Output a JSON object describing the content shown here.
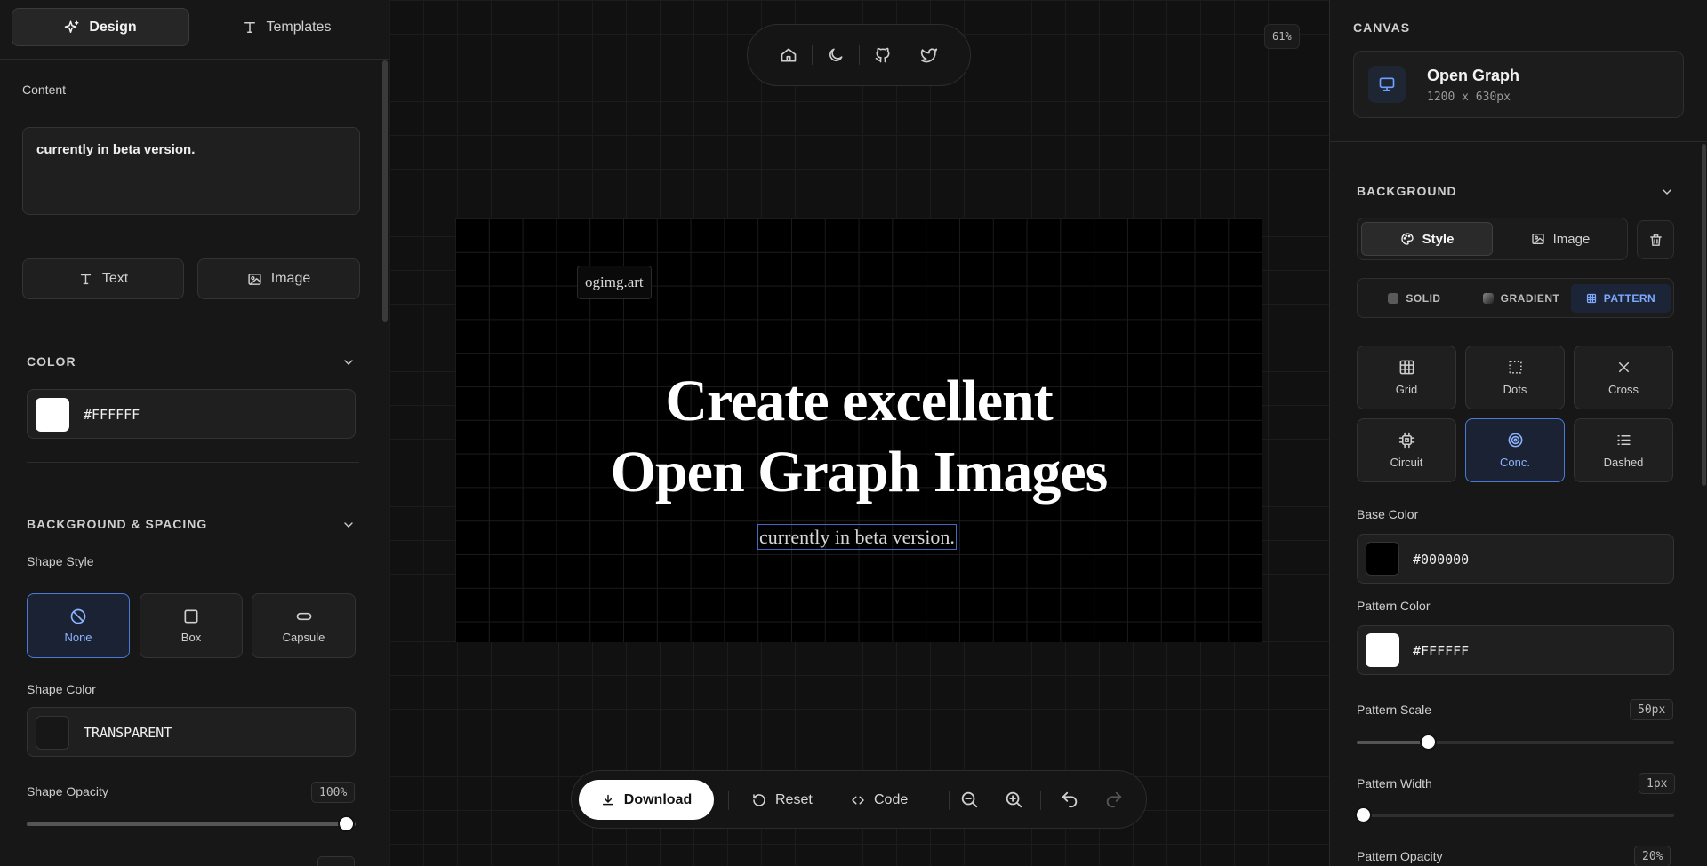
{
  "left": {
    "tabs": [
      {
        "label": "Design",
        "icon": "sparkles-icon",
        "active": true
      },
      {
        "label": "Templates",
        "icon": "text-type-icon",
        "active": false
      }
    ],
    "content_label": "Content",
    "content_value": "currently in beta version.",
    "add_text_label": "Text",
    "add_image_label": "Image",
    "color_heading": "COLOR",
    "color_value": "#FFFFFF",
    "bg_spacing_heading": "BACKGROUND & SPACING",
    "shape_style_label": "Shape Style",
    "shape_options": [
      {
        "label": "None",
        "icon": "ban-icon",
        "active": true
      },
      {
        "label": "Box",
        "icon": "square-icon",
        "active": false
      },
      {
        "label": "Capsule",
        "icon": "capsule-icon",
        "active": false
      }
    ],
    "shape_color_label": "Shape Color",
    "shape_color_value": "TRANSPARENT",
    "shape_opacity_label": "Shape Opacity",
    "shape_opacity_value": "100%",
    "shape_opacity_level": 1.0
  },
  "center": {
    "zoom": "61%",
    "nav_icons": [
      "home-icon",
      "moon-icon",
      "github-icon",
      "twitter-icon"
    ],
    "og": {
      "logo": "ogimg.art",
      "headline_1": "Create excellent",
      "headline_2": "Open Graph Images",
      "tagline": "currently in beta version."
    },
    "toolbar": {
      "download_label": "Download",
      "reset_label": "Reset",
      "code_label": "Code"
    }
  },
  "right": {
    "canvas_heading": "CANVAS",
    "canvas_name": "Open Graph",
    "canvas_size": "1200 x 630px",
    "background_heading": "BACKGROUND",
    "bg_tabs": [
      {
        "label": "Style",
        "active": true
      },
      {
        "label": "Image",
        "active": false
      }
    ],
    "modes": [
      {
        "label": "SOLID",
        "active": false
      },
      {
        "label": "GRADIENT",
        "active": false
      },
      {
        "label": "PATTERN",
        "active": true
      }
    ],
    "patterns": [
      {
        "label": "Grid",
        "icon": "grid-icon",
        "active": false
      },
      {
        "label": "Dots",
        "icon": "dots-icon",
        "active": false
      },
      {
        "label": "Cross",
        "icon": "x-icon",
        "active": false
      },
      {
        "label": "Circuit",
        "icon": "circuit-icon",
        "active": false
      },
      {
        "label": "Conc.",
        "icon": "concentric-icon",
        "active": true
      },
      {
        "label": "Dashed",
        "icon": "dashed-lines-icon",
        "active": false
      }
    ],
    "base_color_label": "Base Color",
    "base_color_value": "#000000",
    "pattern_color_label": "Pattern Color",
    "pattern_color_value": "#FFFFFF",
    "pattern_scale_label": "Pattern Scale",
    "pattern_scale_value": "50px",
    "pattern_width_label": "Pattern Width",
    "pattern_width_value": "1px",
    "pattern_opacity_label": "Pattern Opacity",
    "pattern_opacity_value": "20%"
  },
  "colors": {
    "accent": "#4a7ad6",
    "accent_text": "#8db4ff",
    "panel": "#171717",
    "canvas_bg": "#111112"
  }
}
